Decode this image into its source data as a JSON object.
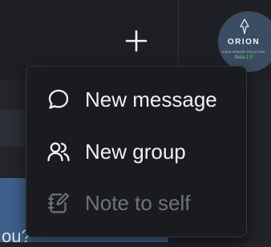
{
  "header": {
    "compose_icon": "plus-icon",
    "logo": {
      "name": "ORION",
      "subtitle": "DATA MINING SOLUTION",
      "tagline": "Beta 1.0"
    }
  },
  "background": {
    "partial_text": "ou?"
  },
  "menu": {
    "items": [
      {
        "label": "New message",
        "icon": "chat-bubble-icon",
        "enabled": true
      },
      {
        "label": "New group",
        "icon": "users-icon",
        "enabled": true
      },
      {
        "label": "Note to self",
        "icon": "note-edit-icon",
        "enabled": false
      }
    ]
  },
  "colors": {
    "menu_bg": "#1a1b1e",
    "menu_text": "#eef0f3",
    "disabled_text": "#6f737b",
    "logo_bg": "#3b4c63",
    "logo_tag": "#5fd36a",
    "panel_accent": "#3d5f8a"
  }
}
